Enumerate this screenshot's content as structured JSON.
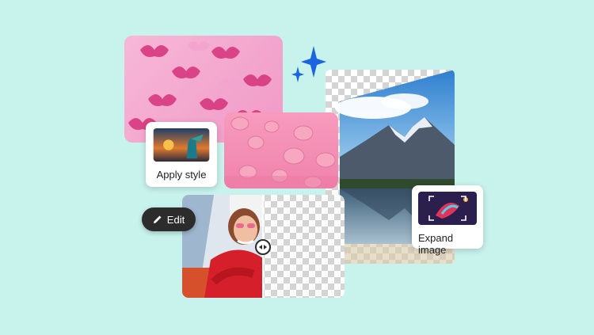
{
  "labels": {
    "apply_style": "Apply style",
    "edit": "Edit",
    "expand_image": "Expand image"
  },
  "colors": {
    "background": "#c8f2ec",
    "butterfly_bg": "#f4a9cf",
    "butterfly": "#d8387f",
    "macaron_bg": "#f390b6",
    "macaron": "#f7a7c0",
    "sparkle": "#1b63e0",
    "sky": "#3a8fd6",
    "mountain": "#4c5a6b",
    "lake": "#5b7e9a",
    "sweater": "#d5202b",
    "pill": "#2c2c2c"
  },
  "icons": [
    "sparkle-icon",
    "pencil-icon",
    "expand-frame-icon",
    "split-handle-icon"
  ]
}
